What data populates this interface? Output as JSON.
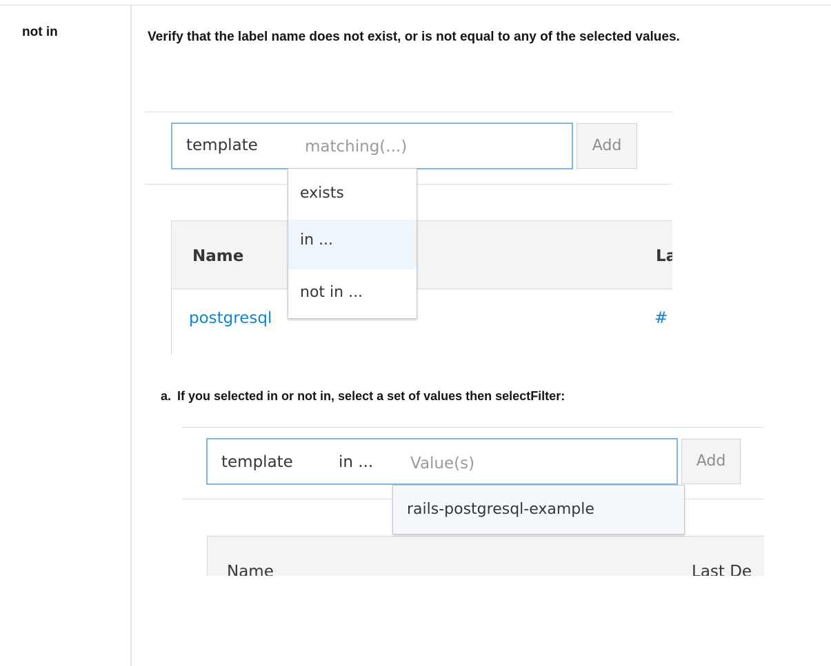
{
  "term": "not in",
  "description": "Verify that the label name does not exist, or is not equal to any of the selected values.",
  "step": {
    "label": "a.",
    "text_1": "If you selected ",
    "bold_1": "in",
    "text_2": " or ",
    "bold_2": "not in",
    "text_3": ", select a set of values then select",
    "bold_3": "Filter",
    "text_4": ":"
  },
  "screenshot_1": {
    "filter_key": "template",
    "filter_placeholder": "matching(...)",
    "add_button": "Add",
    "menu_items": [
      "exists",
      "in ...",
      "not in ..."
    ],
    "table_headers": [
      "Name",
      "La"
    ],
    "row_name": "postgresql",
    "row_extra": "#"
  },
  "screenshot_2": {
    "filter_key": "template",
    "filter_operator": "in ...",
    "filter_placeholder": "Value(s)",
    "add_button": "Add",
    "suggestion": "rails-postgresql-example",
    "table_headers": [
      "Name",
      "Last De"
    ]
  }
}
